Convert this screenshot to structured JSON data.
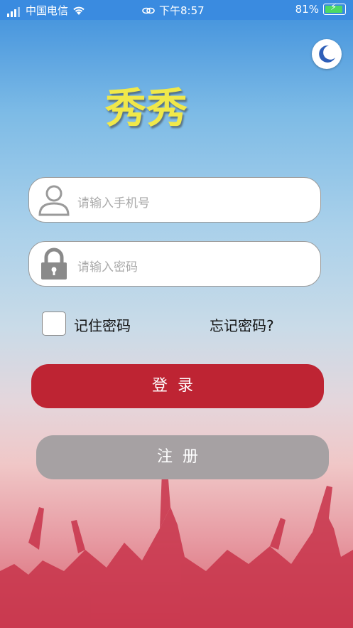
{
  "status_bar": {
    "carrier": "中国电信",
    "time": "下午8:57",
    "battery": "81%"
  },
  "app": {
    "title": "秀秀"
  },
  "form": {
    "phone_placeholder": "请输入手机号",
    "password_placeholder": "请输入密码",
    "remember_label": "记住密码",
    "forgot_label": "忘记密码?",
    "login_label": "登录",
    "register_label": "注册"
  },
  "colors": {
    "login_button": "#be2433",
    "register_button": "#a6a1a3",
    "title": "#f0e84a",
    "status_bar": "#3a8be0"
  },
  "icons": [
    "signal-icon",
    "wifi-icon",
    "link-icon",
    "battery-icon",
    "moon-icon",
    "user-icon",
    "lock-icon"
  ]
}
